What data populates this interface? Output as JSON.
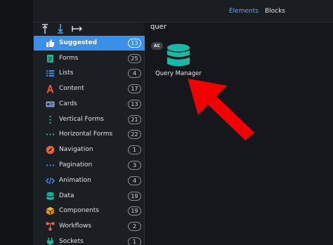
{
  "header": {
    "tabs": [
      {
        "label": "Elements",
        "active": true
      },
      {
        "label": "Blocks",
        "active": false
      }
    ]
  },
  "sort": {
    "icons": [
      "align-top-icon",
      "align-bottom-icon",
      "arrow-right-icon"
    ]
  },
  "search": {
    "value": "quer"
  },
  "sidebar": {
    "items": [
      {
        "label": "Suggested",
        "count": "13",
        "icon": "thumbs-up-icon",
        "active": true
      },
      {
        "label": "Forms",
        "count": "25",
        "icon": "form-document-icon"
      },
      {
        "label": "Lists",
        "count": "4",
        "icon": "list-icon"
      },
      {
        "label": "Content",
        "count": "17",
        "icon": "letter-a-icon"
      },
      {
        "label": "Cards",
        "count": "13",
        "icon": "card-icon"
      },
      {
        "label": "Vertical Forms",
        "count": "21",
        "icon": "vertical-dots-icon"
      },
      {
        "label": "Horizontal Forms",
        "count": "22",
        "icon": "horizontal-dots-icon"
      },
      {
        "label": "Navigation",
        "count": "1",
        "icon": "compass-icon"
      },
      {
        "label": "Pagination",
        "count": "3",
        "icon": "pagination-dots-icon"
      },
      {
        "label": "Animation",
        "count": "4",
        "icon": "code-icon"
      },
      {
        "label": "Data",
        "count": "19",
        "icon": "database-icon"
      },
      {
        "label": "Components",
        "count": "19",
        "icon": "cube-icon"
      },
      {
        "label": "Workflows",
        "count": "2",
        "icon": "workflow-icon"
      },
      {
        "label": "Sockets",
        "count": "1",
        "icon": "plug-icon"
      }
    ]
  },
  "results": {
    "badge": "AC",
    "items": [
      {
        "name": "Query Manager",
        "icon": "database-icon"
      }
    ]
  },
  "colors": {
    "accent": "#3a8fe7",
    "arrow": "#f00000",
    "database": "#1ab8a6"
  }
}
